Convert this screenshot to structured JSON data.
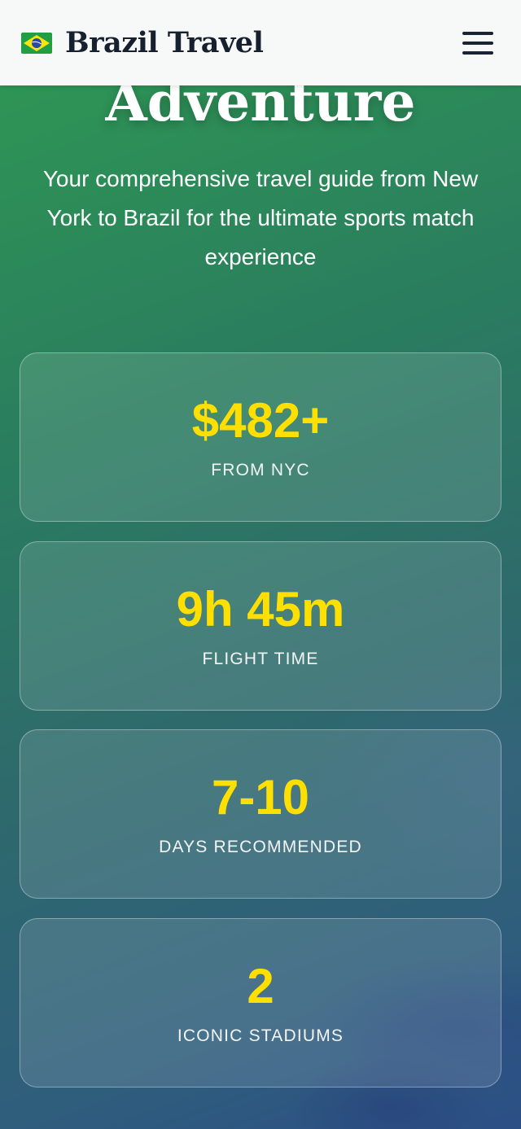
{
  "header": {
    "brand_name": "Brazil Travel",
    "flag_icon": "brazil-flag-icon",
    "menu_icon": "hamburger-menu-icon"
  },
  "hero": {
    "title": "Adventure",
    "subtitle": "Your comprehensive travel guide from New York to Brazil for the ultimate sports match experience"
  },
  "stats": [
    {
      "value": "$482+",
      "label": "FROM NYC"
    },
    {
      "value": "9h 45m",
      "label": "FLIGHT TIME"
    },
    {
      "value": "7-10",
      "label": "DAYS RECOMMENDED"
    },
    {
      "value": "2",
      "label": "ICONIC STADIUMS"
    }
  ],
  "colors": {
    "accent": "#ffdf00",
    "header_bg": "#f7f9f9",
    "brand_text": "#16202e",
    "gradient_start": "#2f9a52",
    "gradient_end": "#2c4f86"
  }
}
